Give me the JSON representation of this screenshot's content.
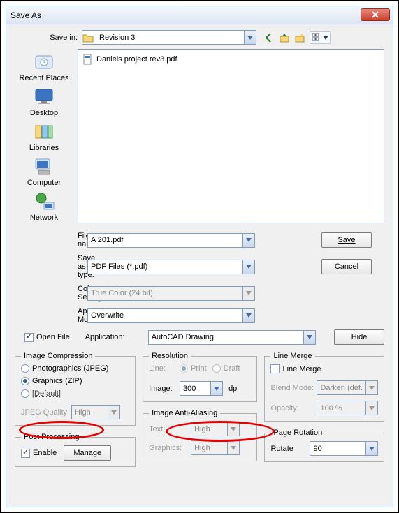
{
  "window": {
    "title": "Save As"
  },
  "savein": {
    "label": "Save in:",
    "value": "Revision 3"
  },
  "sidebar": {
    "items": [
      {
        "label": "Recent Places"
      },
      {
        "label": "Desktop"
      },
      {
        "label": "Libraries"
      },
      {
        "label": "Computer"
      },
      {
        "label": "Network"
      }
    ]
  },
  "filelist": {
    "items": [
      {
        "name": "Daniels project rev3.pdf"
      }
    ]
  },
  "form": {
    "filename_label": "File name:",
    "filename_value": "A 201.pdf",
    "saveastype_label": "Save as type:",
    "saveastype_value": "PDF Files (*.pdf)",
    "colorsetting_label": "Color Setting:",
    "colorsetting_value": "True Color (24 bit)",
    "appendmode_label": "Append Mode:",
    "appendmode_value": "Overwrite",
    "application_label": "Application:",
    "application_value": "AutoCAD Drawing",
    "openfile_label": "Open File"
  },
  "buttons": {
    "save": "Save",
    "cancel": "Cancel",
    "hide": "Hide",
    "manage": "Manage"
  },
  "image_compression": {
    "legend": "Image Compression",
    "opt_jpeg": "Photographics (JPEG)",
    "opt_zip": "Graphics (ZIP)",
    "opt_default": "[Default]",
    "jpeg_quality_label": "JPEG Quality",
    "jpeg_quality_value": "High"
  },
  "post_processing": {
    "legend": "Post Processing",
    "enable_label": "Enable"
  },
  "resolution": {
    "legend": "Resolution",
    "line_label": "Line:",
    "print_label": "Print",
    "draft_label": "Draft",
    "image_label": "Image:",
    "image_value": "300",
    "dpi_label": "dpi"
  },
  "anti_aliasing": {
    "legend": "Image Anti-Aliasing",
    "text_label": "Text:",
    "text_value": "High",
    "graphics_label": "Graphics:",
    "graphics_value": "High"
  },
  "line_merge": {
    "legend": "Line Merge",
    "checkbox_label": "Line Merge",
    "blend_label": "Blend Mode:",
    "blend_value": "Darken (def.",
    "opacity_label": "Opacity:",
    "opacity_value": "100 %"
  },
  "page_rotation": {
    "legend": "Page Rotation",
    "rotate_label": "Rotate",
    "rotate_value": "90"
  }
}
